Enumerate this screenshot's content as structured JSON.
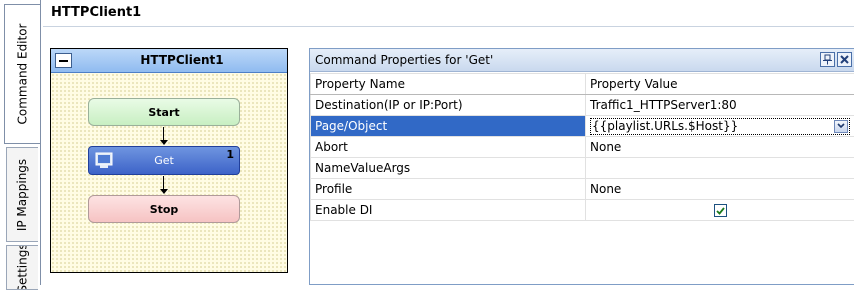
{
  "tabs": [
    {
      "label": "Command Editor",
      "active": true
    },
    {
      "label": "IP Mappings",
      "active": false
    },
    {
      "label": "Settings",
      "active": false
    }
  ],
  "main": {
    "title": "HTTPClient1"
  },
  "flow": {
    "title": "HTTPClient1",
    "start_label": "Start",
    "get_label": "Get",
    "get_number": "1",
    "stop_label": "Stop"
  },
  "props": {
    "title": "Command Properties for 'Get'",
    "columns": [
      "Property Name",
      "Property Value"
    ],
    "rows": [
      {
        "name": "Destination(IP or IP:Port)",
        "value": "Traffic1_HTTPServer1:80"
      },
      {
        "name": "Page/Object",
        "value": "{{playlist.URLs.$Host}}",
        "selected": true
      },
      {
        "name": "Abort",
        "value": "None"
      },
      {
        "name": "NameValueArgs",
        "value": ""
      },
      {
        "name": "Profile",
        "value": "None"
      },
      {
        "name": "Enable DI",
        "value": "",
        "checked": true
      }
    ]
  },
  "colors": {
    "selected_row": "#3169c6",
    "flow_header": "#8fbbf0",
    "get_node": "#3d63c8",
    "start_node": "#c8efc2",
    "stop_node": "#f6c3c3"
  }
}
